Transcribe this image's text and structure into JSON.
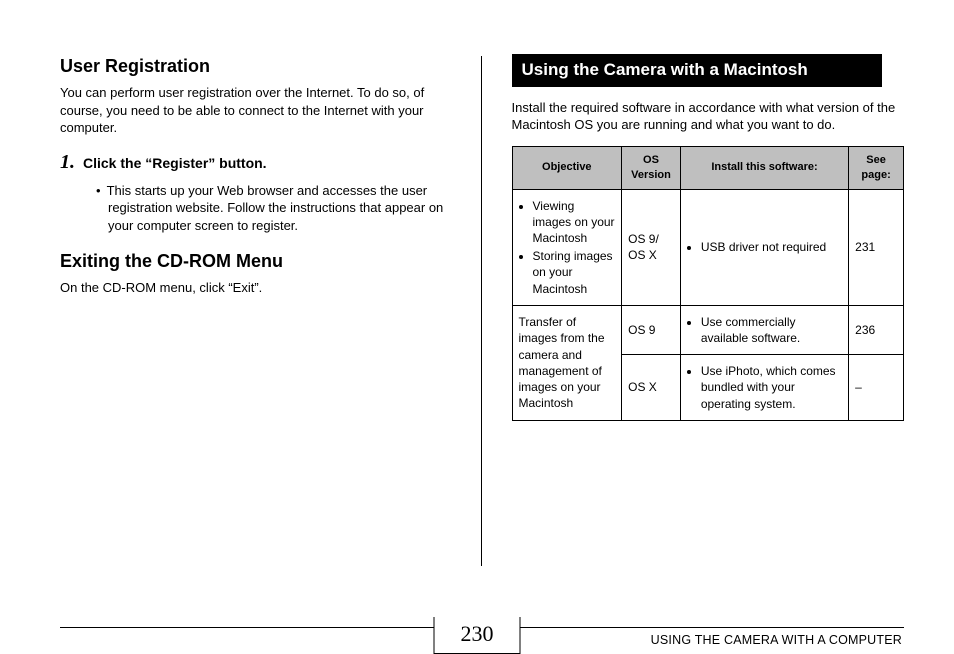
{
  "left": {
    "h_user_reg": "User Registration",
    "user_reg_para": "You can perform user registration over the Internet. To do so, of course, you need to be able to connect to the Internet with your computer.",
    "step_num": "1.",
    "step_text": "Click the “Register” button.",
    "step_sub": "This starts up your Web browser and accesses the user registration website. Follow the instructions that appear on your computer screen to register.",
    "h_exit": "Exiting the CD-ROM Menu",
    "exit_para": "On the CD-ROM menu, click “Exit”."
  },
  "right": {
    "banner": "Using the Camera with a Macintosh",
    "intro": "Install the required software in accordance with what version of the Macintosh OS you are running and what you want to do.",
    "th_obj": "Objective",
    "th_os": "OS Version",
    "th_sw": "Install this software:",
    "th_pg": "See page:",
    "r1_obj_a": "Viewing images on your Macintosh",
    "r1_obj_b": "Storing images on your Macintosh",
    "r1_os": "OS 9/ OS X",
    "r1_sw": "USB driver not required",
    "r1_pg": "231",
    "r23_obj": "Transfer of images from the camera and management of images on your Macintosh",
    "r2_os": "OS 9",
    "r2_sw": "Use commercially available software.",
    "r2_pg": "236",
    "r3_os": "OS X",
    "r3_sw": "Use iPhoto, which comes bundled with your operating system.",
    "r3_pg": "–"
  },
  "footer": {
    "page_num": "230",
    "right_text": "USING THE CAMERA WITH A COMPUTER"
  }
}
